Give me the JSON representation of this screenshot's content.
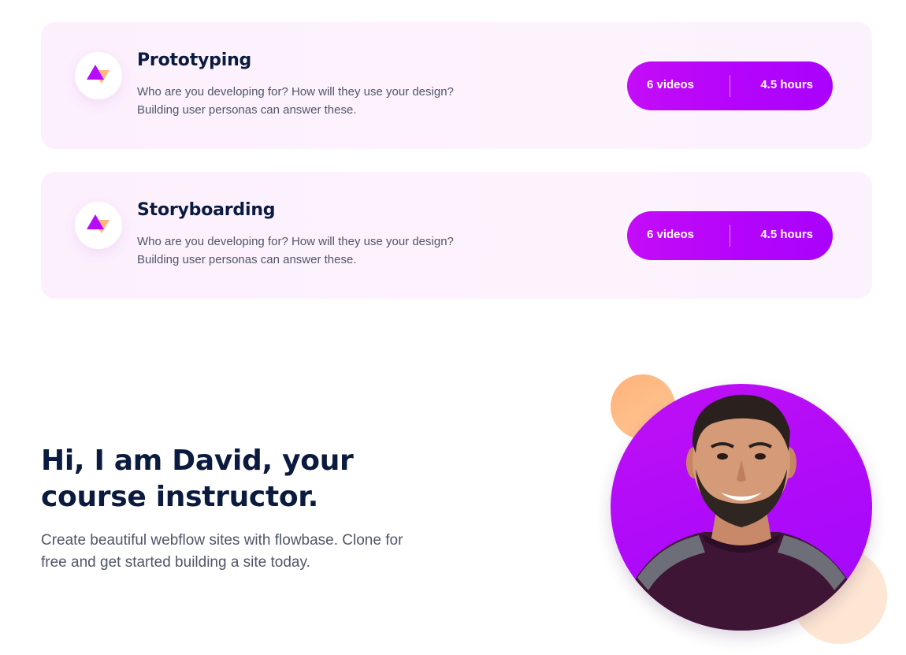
{
  "modules": [
    {
      "title": "Prototyping",
      "description_lines": [
        "Who are you developing for? How will they use your design?",
        "Building user personas can answer these."
      ],
      "videos": "6 videos",
      "hours": "4.5 hours",
      "icon": "triangles-logo-icon"
    },
    {
      "title": "Storyboarding",
      "description_lines": [
        "Who are you developing for? How will they use your design?",
        "Building user personas can answer these."
      ],
      "videos": "6 videos",
      "hours": "4.5 hours",
      "icon": "triangles-logo-icon"
    }
  ],
  "instructor": {
    "heading_lines": [
      "Hi, I am David, your",
      "course instructor."
    ],
    "text_lines": [
      "Create beautiful webflow sites with flowbase. Clone for",
      "free and get started building a site today."
    ],
    "photo": "instructor-portrait"
  },
  "colors": {
    "accent_purple": "#b404fb",
    "card_background": "#fcf0fd",
    "heading_navy": "#0a1b3f",
    "body_gray": "#4f5667",
    "deco_orange": "#ffb17a",
    "deco_peach": "#fde6d4"
  }
}
